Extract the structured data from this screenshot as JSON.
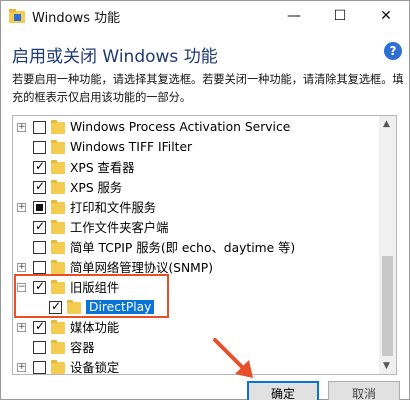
{
  "window": {
    "title": "Windows 功能",
    "minimize_glyph": "—",
    "maximize_glyph": "☐",
    "close_glyph": "✕"
  },
  "header": {
    "heading": "启用或关闭 Windows 功能",
    "help_glyph": "?",
    "description": "若要启用一种功能，请选择其复选框。若要关闭一种功能，请清除其复选框。填充的框表示仅启用该功能的一部分。"
  },
  "features": [
    {
      "label": "Windows Process Activation Service",
      "state": "unchecked",
      "expander": "+",
      "level": 0
    },
    {
      "label": "Windows TIFF IFilter",
      "state": "unchecked",
      "expander": "",
      "level": 0
    },
    {
      "label": "XPS 查看器",
      "state": "checked",
      "expander": "",
      "level": 0
    },
    {
      "label": "XPS 服务",
      "state": "checked",
      "expander": "",
      "level": 0
    },
    {
      "label": "打印和文件服务",
      "state": "partial",
      "expander": "+",
      "level": 0
    },
    {
      "label": "工作文件夹客户端",
      "state": "checked",
      "expander": "",
      "level": 0
    },
    {
      "label": "简单 TCPIP 服务(即 echo、daytime 等)",
      "state": "unchecked",
      "expander": "",
      "level": 0
    },
    {
      "label": "简单网络管理协议(SNMP)",
      "state": "unchecked",
      "expander": "+",
      "level": 0
    },
    {
      "label": "旧版组件",
      "state": "checked",
      "expander": "−",
      "level": 0
    },
    {
      "label": "DirectPlay",
      "state": "checked",
      "expander": "",
      "level": 1,
      "selected": true
    },
    {
      "label": "媒体功能",
      "state": "checked",
      "expander": "+",
      "level": 0
    },
    {
      "label": "容器",
      "state": "unchecked",
      "expander": "",
      "level": 0
    },
    {
      "label": "设备锁定",
      "state": "unchecked",
      "expander": "+",
      "level": 0
    }
  ],
  "buttons": {
    "ok": "确定",
    "cancel": "取消"
  },
  "colors": {
    "accent": "#0a74d6",
    "annotation_red": "#e8502a",
    "folder": "#f4cc52"
  }
}
